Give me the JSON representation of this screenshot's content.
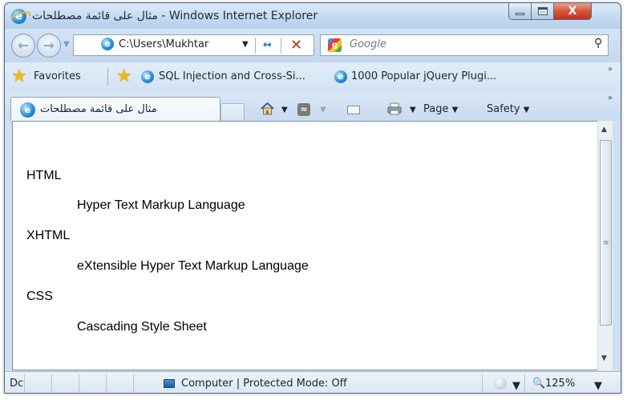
{
  "window": {
    "title": "مثال على قائمة مصطلحات - Windows Internet Explorer",
    "close_glyph": "X"
  },
  "address": {
    "url": "C:\\Users\\Mukhtar",
    "search_placeholder": "Google"
  },
  "favorites": {
    "label": "Favorites",
    "items": [
      {
        "label": "SQL Injection and Cross-Si..."
      },
      {
        "label": "1000 Popular jQuery Plugi..."
      }
    ]
  },
  "tab": {
    "title": "مثال على قائمة مصطلحات"
  },
  "commands": {
    "page": "Page",
    "safety": "Safety"
  },
  "content": {
    "terms": [
      {
        "term": "HTML",
        "definition": "Hyper Text Markup Language"
      },
      {
        "term": "XHTML",
        "definition": "eXtensible Hyper Text Markup Language"
      },
      {
        "term": "CSS",
        "definition": "Cascading Style Sheet"
      }
    ]
  },
  "status": {
    "left_text": "Dc",
    "zone": "Computer | Protected Mode: Off",
    "zoom": "125%"
  },
  "colors": {
    "window_frame": "#cfe0f2",
    "close_button": "#d6553a",
    "stop_icon": "#d42a1c",
    "favorites_star": "#f0b818"
  }
}
